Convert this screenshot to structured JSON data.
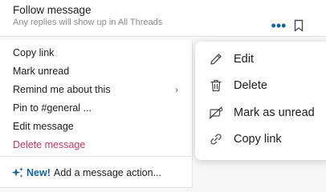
{
  "header": {
    "title": "Follow message",
    "subtitle": "Any replies will show up in All Threads",
    "more_label": "•••"
  },
  "context_menu": {
    "items": [
      {
        "label": "Copy link"
      },
      {
        "label": "Mark unread"
      },
      {
        "label": "Remind me about this",
        "chevron": "›"
      },
      {
        "label": "Pin to #general ..."
      },
      {
        "label": "Edit message"
      },
      {
        "label": "Delete message"
      }
    ],
    "footer": {
      "new_tag": "New!",
      "label": "Add a message action..."
    }
  },
  "popup_menu": {
    "items": [
      {
        "label": "Edit",
        "icon": "pencil-icon"
      },
      {
        "label": "Delete",
        "icon": "trash-icon"
      },
      {
        "label": "Mark as unread",
        "icon": "unread-icon"
      },
      {
        "label": "Copy link",
        "icon": "link-icon"
      }
    ]
  },
  "colors": {
    "accent": "#1264a3",
    "danger": "#c03a5c",
    "subtle_text": "#8a8a8a"
  }
}
